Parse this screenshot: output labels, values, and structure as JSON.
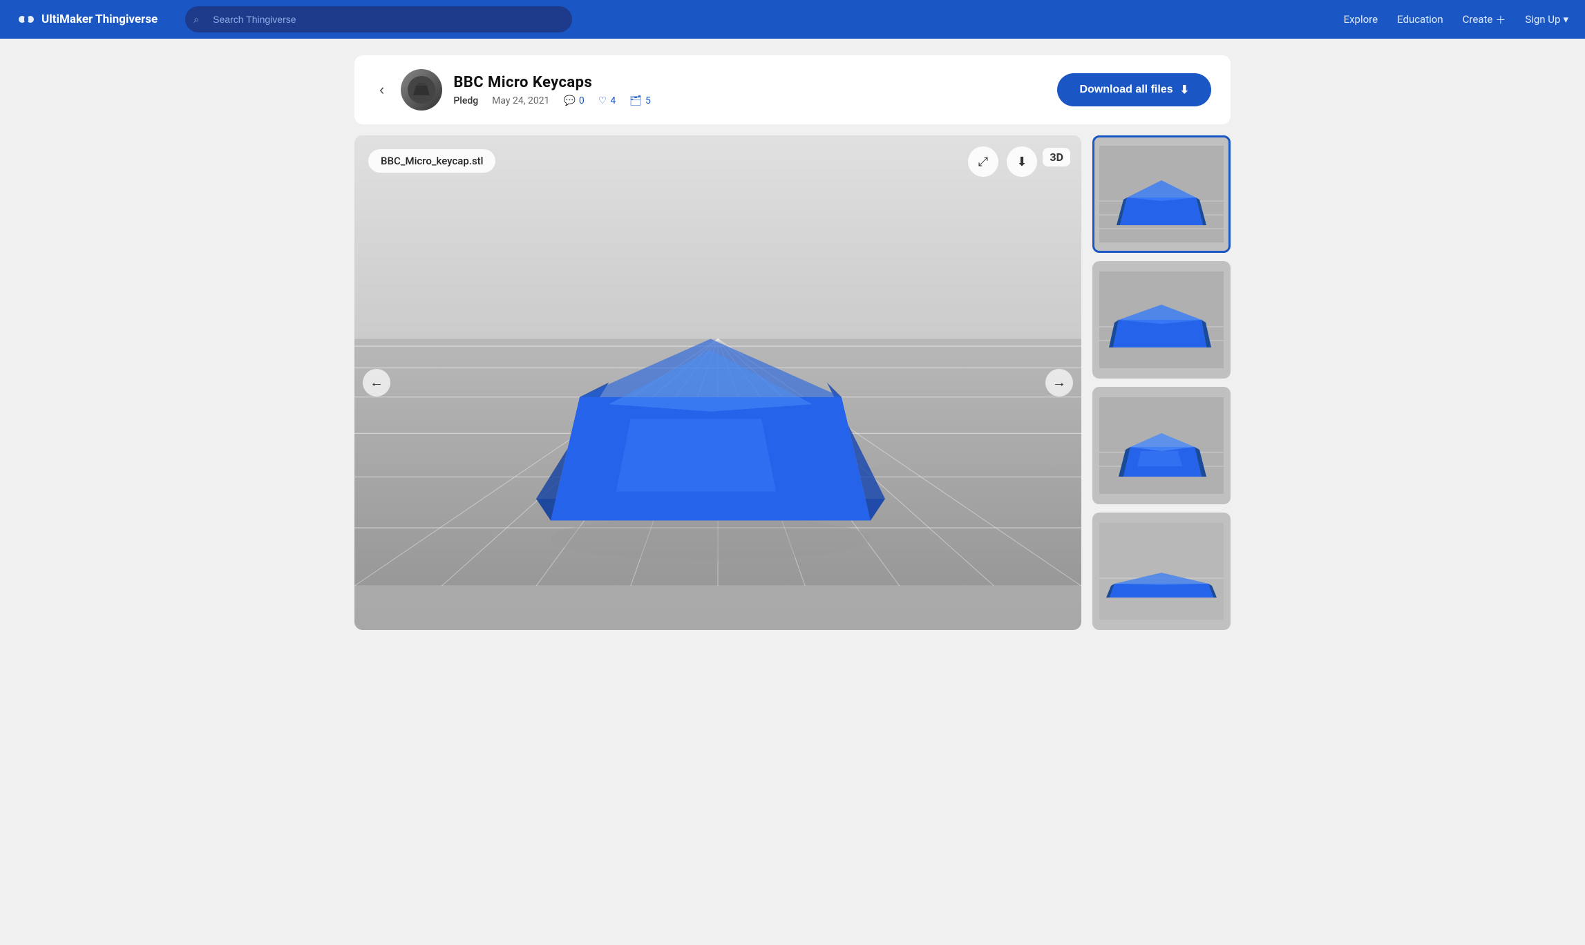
{
  "nav": {
    "logo_text": "UltiMaker Thingiverse",
    "search_placeholder": "Search Thingiverse",
    "explore": "Explore",
    "education": "Education",
    "create": "Create",
    "signup": "Sign Up"
  },
  "item": {
    "title": "BBC Micro Keycaps",
    "author": "Pledg",
    "date": "May 24, 2021",
    "comments": "0",
    "likes": "4",
    "collections": "5",
    "download_btn": "Download all files",
    "file_label": "BBC_Micro_keycap.stl",
    "badge_3d": "3D"
  },
  "thumbnails": [
    {
      "id": 1,
      "active": true
    },
    {
      "id": 2,
      "active": false
    },
    {
      "id": 3,
      "active": false
    },
    {
      "id": 4,
      "active": false
    }
  ],
  "colors": {
    "nav_bg": "#1a56c4",
    "accent": "#1a56c4",
    "keycap_blue": "#2563eb",
    "keycap_dark": "#1a4aaa"
  }
}
